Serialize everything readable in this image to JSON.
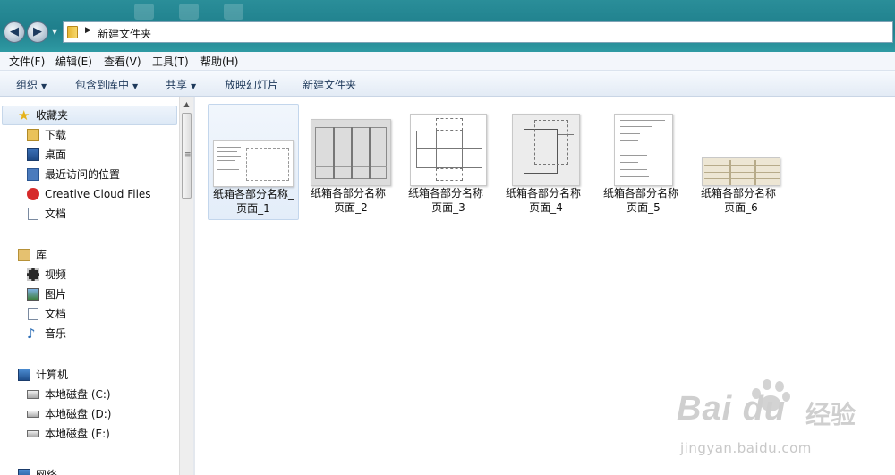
{
  "window": {
    "title_bar_color": "#1f7f8c"
  },
  "navigation": {
    "back_glyph": "◀",
    "forward_glyph": "▶"
  },
  "address": {
    "path": "新建文件夹"
  },
  "menu": {
    "items": [
      {
        "label": "文件(F)"
      },
      {
        "label": "编辑(E)"
      },
      {
        "label": "查看(V)"
      },
      {
        "label": "工具(T)"
      },
      {
        "label": "帮助(H)"
      }
    ]
  },
  "toolbar": {
    "organize": "组织",
    "include_in_library": "包含到库中",
    "share": "共享",
    "slideshow": "放映幻灯片",
    "new_folder": "新建文件夹"
  },
  "sidebar": {
    "favorites": {
      "label": "收藏夹",
      "items": [
        {
          "label": "下载",
          "icon": "download-folder-icon"
        },
        {
          "label": "桌面",
          "icon": "desktop-icon"
        },
        {
          "label": "最近访问的位置",
          "icon": "recent-places-icon"
        },
        {
          "label": "Creative Cloud Files",
          "icon": "creative-cloud-icon"
        },
        {
          "label": "文档",
          "icon": "document-icon"
        }
      ]
    },
    "libraries": {
      "label": "库",
      "items": [
        {
          "label": "视频",
          "icon": "video-icon"
        },
        {
          "label": "图片",
          "icon": "pictures-icon"
        },
        {
          "label": "文档",
          "icon": "document-icon"
        },
        {
          "label": "音乐",
          "icon": "music-icon"
        }
      ]
    },
    "computer": {
      "label": "计算机",
      "items": [
        {
          "label": "本地磁盘 (C:)",
          "icon": "system-drive-icon"
        },
        {
          "label": "本地磁盘 (D:)",
          "icon": "drive-icon"
        },
        {
          "label": "本地磁盘 (E:)",
          "icon": "drive-icon"
        }
      ]
    },
    "network": {
      "label": "网络"
    }
  },
  "files": [
    {
      "line1": "纸箱各部分名称_",
      "line2": "页面_1",
      "selected": true
    },
    {
      "line1": "纸箱各部分名称_",
      "line2": "页面_2",
      "selected": false
    },
    {
      "line1": "纸箱各部分名称_",
      "line2": "页面_3",
      "selected": false
    },
    {
      "line1": "纸箱各部分名称_",
      "line2": "页面_4",
      "selected": false
    },
    {
      "line1": "纸箱各部分名称_",
      "line2": "页面_5",
      "selected": false
    },
    {
      "line1": "纸箱各部分名称_",
      "line2": "页面_6",
      "selected": false
    }
  ],
  "watermark": {
    "brand": "Bai du",
    "cn": "经验",
    "url": "jingyan.baidu.com"
  }
}
